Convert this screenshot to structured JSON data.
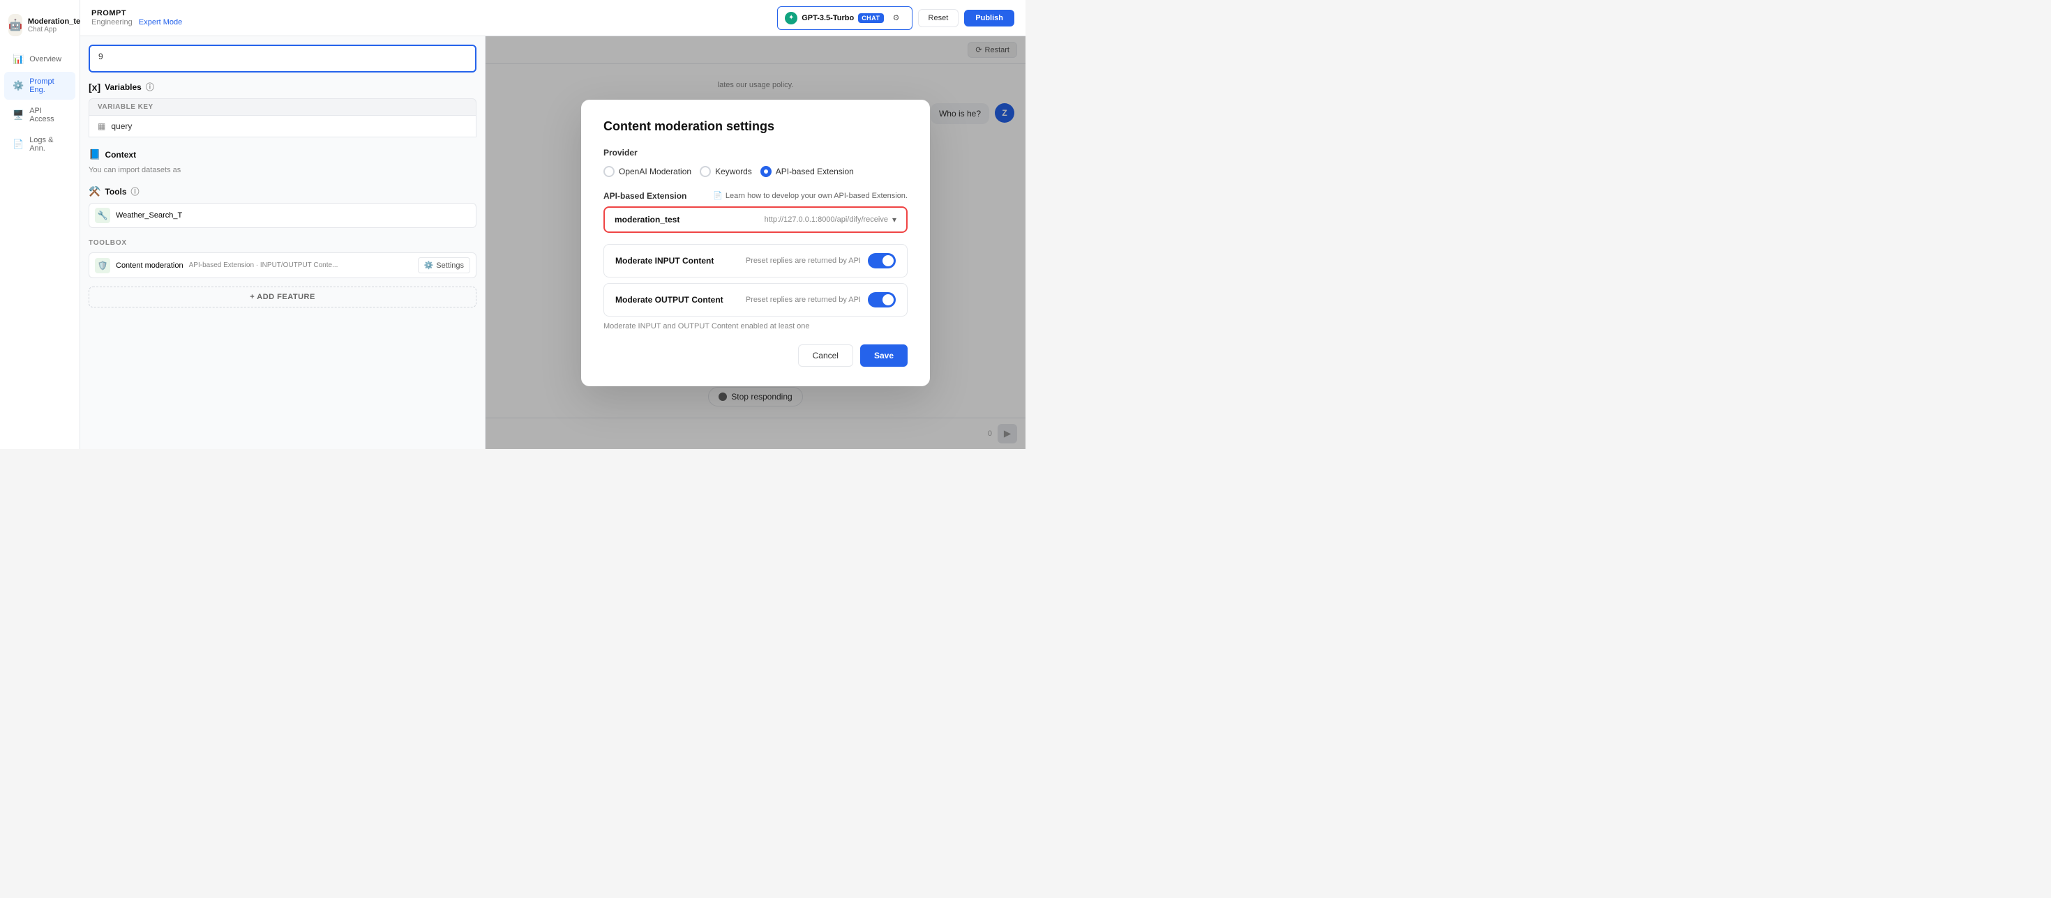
{
  "app": {
    "icon": "🤖",
    "name": "Moderation_test",
    "type": "Chat App"
  },
  "sidebar": {
    "items": [
      {
        "label": "Overview",
        "icon": "📊",
        "active": false
      },
      {
        "label": "Prompt Eng.",
        "icon": "⚙️",
        "active": true
      },
      {
        "label": "API Access",
        "icon": "🖥️",
        "active": false
      },
      {
        "label": "Logs & Ann.",
        "icon": "📄",
        "active": false
      }
    ]
  },
  "topbar": {
    "prompt_label": "PROMPT",
    "mode_label": "Engineering",
    "expert_mode_label": "Expert Mode",
    "model_name": "GPT-3.5-Turbo",
    "chat_badge": "CHAT",
    "reset_label": "Reset",
    "publish_label": "Publish"
  },
  "left_panel": {
    "prompt_line_number": "9",
    "variables_label": "Variables",
    "variable_key_header": "VARIABLE KEY",
    "variable_query": "query",
    "context_label": "Context",
    "context_desc": "You can import datasets as",
    "tools_label": "Tools",
    "tool_name": "Weather_Search_T",
    "toolbox_label": "TOOLBOX",
    "content_mod_label": "Content moderation",
    "content_mod_desc": "API-based Extension · INPUT/OUTPUT Conte...",
    "settings_label": "Settings",
    "add_feature_label": "+ ADD FEATURE"
  },
  "right_panel": {
    "restart_label": "⟳ Restart",
    "chat_bubble": "Who is he?",
    "user_initial": "Z",
    "system_msg": "lates our usage policy.",
    "stop_responding_label": "Stop responding",
    "char_count": "0"
  },
  "modal": {
    "title": "Content moderation settings",
    "provider_label": "Provider",
    "providers": [
      {
        "label": "OpenAI Moderation",
        "selected": false
      },
      {
        "label": "Keywords",
        "selected": false
      },
      {
        "label": "API-based Extension",
        "selected": true
      }
    ],
    "api_extension_label": "API-based Extension",
    "api_learn_link": "Learn how to develop your own API-based Extension.",
    "api_dropdown_name": "moderation_test",
    "api_dropdown_url": "http://127.0.0.1:8000/api/dify/receive",
    "moderate_input_label": "Moderate INPUT Content",
    "moderate_input_desc": "Preset replies are returned by API",
    "moderate_input_enabled": true,
    "moderate_output_label": "Moderate OUTPUT Content",
    "moderate_output_desc": "Preset replies are returned by API",
    "moderate_output_enabled": true,
    "warning_text": "Moderate INPUT and OUTPUT Content enabled at least one",
    "cancel_label": "Cancel",
    "save_label": "Save"
  }
}
